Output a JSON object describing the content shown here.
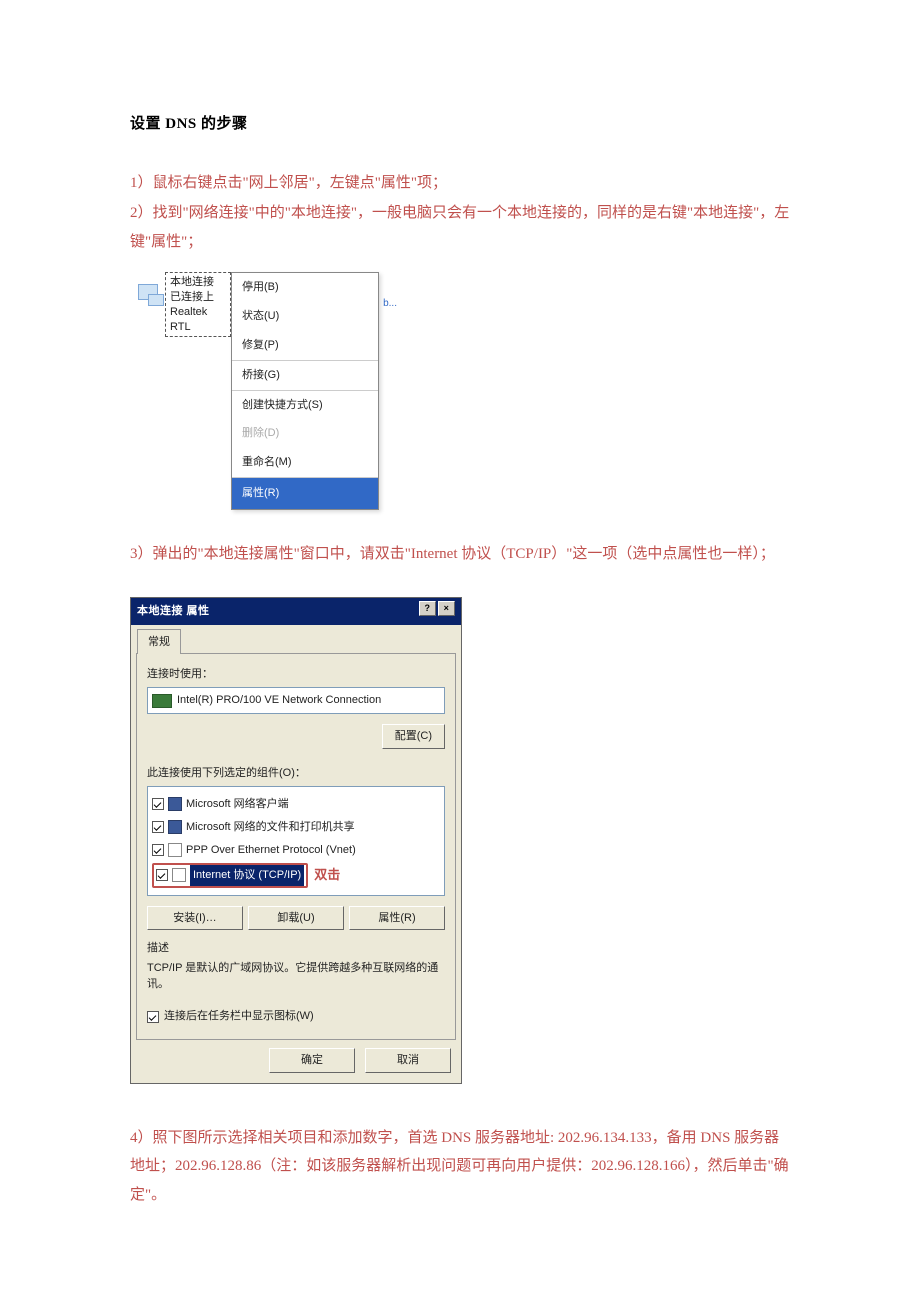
{
  "title": "设置 DNS 的步骤",
  "steps": {
    "s1": "1）鼠标右键点击\"网上邻居\"，左键点\"属性\"项；",
    "s2": "2）找到\"网络连接\"中的\"本地连接\"，一般电脑只会有一个本地连接的，同样的是右键\"本地连接\"，左键\"属性\"；",
    "s3": "3）弹出的\"本地连接属性\"窗口中，请双击\"Internet 协议（TCP/IP）\"这一项（选中点属性也一样）；",
    "s4": "4）照下图所示选择相关项目和添加数字，首选 DNS 服务器地址: 202.96.134.133，备用 DNS 服务器地址；202.96.128.86（注：如该服务器解析出现问题可再向用户提供：202.96.128.166），然后单击\"确定\"。"
  },
  "fig1": {
    "label_line1": "本地连接",
    "label_line2": "已连接上",
    "label_line3": "Realtek RTL",
    "menu": {
      "disable": "停用(B)",
      "status": "状态(U)",
      "repair": "修复(P)",
      "bridge": "桥接(G)",
      "shortcut": "创建快捷方式(S)",
      "delete": "删除(D)",
      "rename": "重命名(M)",
      "properties": "属性(R)"
    },
    "balloon": "b..."
  },
  "fig2": {
    "title": "本地连接 属性",
    "help_btn": "?",
    "close_btn": "×",
    "tab": "常规",
    "connect_using": "连接时使用：",
    "adapter": "Intel(R) PRO/100 VE Network Connection",
    "configure_btn": "配置(C)",
    "components_label": "此连接使用下列选定的组件(O)：",
    "items": {
      "client": "Microsoft 网络客户端",
      "share": "Microsoft 网络的文件和打印机共享",
      "ppp": "PPP Over Ethernet Protocol (Vnet)",
      "tcpip": "Internet 协议 (TCP/IP)"
    },
    "annotation": "双击",
    "install_btn": "安装(I)…",
    "uninstall_btn": "卸载(U)",
    "props_btn": "属性(R)",
    "desc_label": "描述",
    "desc_text": "TCP/IP 是默认的广域网协议。它提供跨越多种互联网络的通讯。",
    "tray_chk": "连接后在任务栏中显示图标(W)",
    "ok_btn": "确定",
    "cancel_btn": "取消"
  }
}
